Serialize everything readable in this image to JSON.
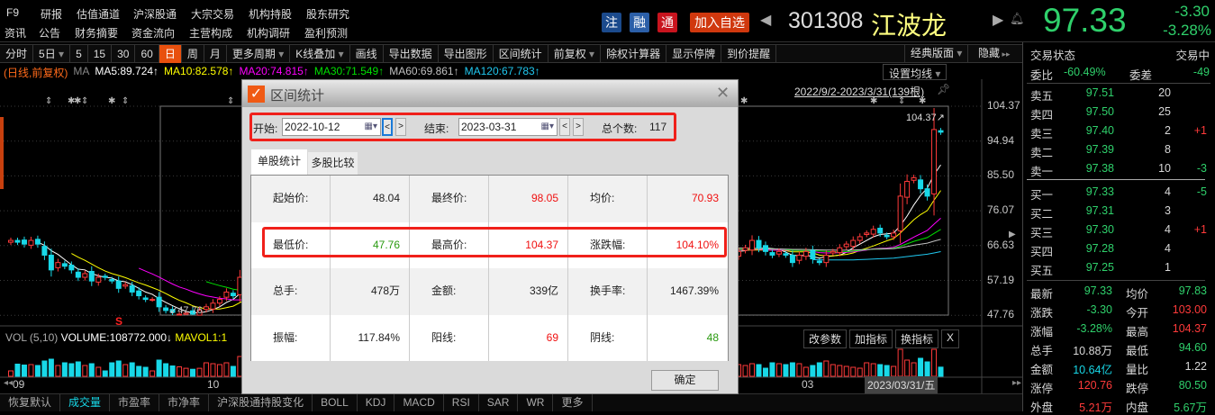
{
  "top_menu": {
    "row1": [
      "F9",
      "研报",
      "估值通道",
      "沪深股通",
      "大宗交易",
      "机构持股",
      "股东研究"
    ],
    "row2": [
      "资讯",
      "公告",
      "财务摘要",
      "资金流向",
      "主营构成",
      "机构调研",
      "盈利预测"
    ]
  },
  "header": {
    "badges": [
      {
        "label": "注",
        "color": "#1b4a8c"
      },
      {
        "label": "融",
        "color": "#2b5fa8"
      },
      {
        "label": "通",
        "color": "#c8141e"
      }
    ],
    "add_watchlist": "加入自选",
    "code": "301308",
    "name": "江波龙",
    "price": "97.33",
    "change": "-3.30",
    "change_pct": "-3.28%"
  },
  "toolbar": {
    "items": [
      {
        "label": "分时"
      },
      {
        "label": "5日",
        "dropdown": true
      },
      {
        "label": "5"
      },
      {
        "label": "15"
      },
      {
        "label": "30"
      },
      {
        "label": "60"
      },
      {
        "label": "日",
        "active": true
      },
      {
        "label": "周"
      },
      {
        "label": "月"
      },
      {
        "label": "更多周期",
        "dropdown": true
      },
      {
        "label": "K线叠加",
        "dropdown": true
      },
      {
        "label": "画线"
      },
      {
        "label": "导出数据"
      },
      {
        "label": "导出图形"
      },
      {
        "label": "区间统计"
      },
      {
        "label": "前复权",
        "dropdown": true
      },
      {
        "label": "除权计算器"
      },
      {
        "label": "显示停牌"
      },
      {
        "label": "到价提醒"
      }
    ],
    "layout": "经典版面",
    "hide": "隐藏"
  },
  "ma_row": {
    "prefix": "(日线,前复权)",
    "ma": "MA",
    "items": [
      {
        "text": "MA5:89.724↑",
        "color": "#ffffff"
      },
      {
        "text": "MA10:82.578↑",
        "color": "#ffff00"
      },
      {
        "text": "MA20:74.815↑",
        "color": "#ff00ff"
      },
      {
        "text": "MA30:71.549↑",
        "color": "#00e000"
      },
      {
        "text": "MA60:69.861↑",
        "color": "#c0c0c0"
      },
      {
        "text": "MA120:67.783↑",
        "color": "#20c8f0"
      }
    ],
    "set_ma": "设置均线"
  },
  "chart": {
    "range_label": "2022/9/2-2023/3/31(139根)",
    "price_axis": [
      "104.37",
      "94.94",
      "85.50",
      "76.07",
      "66.63",
      "57.19",
      "47.76"
    ],
    "low_marker": "47.76",
    "high_marker": "104.37",
    "closes": [
      68,
      67.5,
      67,
      68,
      67,
      64,
      60,
      62,
      61,
      60,
      58,
      59,
      57,
      58,
      58,
      57,
      55,
      56,
      54,
      53,
      52,
      52,
      50,
      49,
      48.5,
      48,
      48.3,
      48.04,
      49,
      50,
      51,
      52,
      54,
      53,
      58,
      57,
      60,
      59,
      62,
      63,
      62,
      64,
      66,
      65,
      67,
      68,
      66,
      67,
      69,
      68,
      70,
      69,
      67,
      68,
      66,
      67,
      66,
      65,
      66,
      67,
      66,
      65,
      67,
      68,
      66,
      65,
      64,
      66,
      67,
      68,
      67,
      66,
      65,
      64,
      63,
      64,
      65,
      66,
      67,
      66,
      65,
      64,
      65,
      66,
      67,
      68,
      67,
      66,
      65,
      64,
      66,
      67,
      68,
      66,
      65,
      64,
      63,
      65,
      66,
      67,
      68,
      66,
      65,
      64,
      65,
      66,
      65,
      64,
      65,
      66,
      68,
      66,
      65,
      64,
      65,
      64,
      62,
      64,
      65,
      63,
      62,
      64,
      65,
      66,
      67,
      68,
      69,
      70,
      71,
      70,
      69,
      70,
      80,
      84,
      85,
      82,
      80,
      98.05,
      97.33
    ]
  },
  "volume": {
    "label": "VOL (5,10)",
    "volume_text": "VOLUME:108772.000↓",
    "mavol_text": "MAVOL1:1",
    "buttons": [
      "改参数",
      "加指标",
      "换指标",
      "X"
    ]
  },
  "date_axis": {
    "labels": [
      "09",
      "10",
      "03"
    ],
    "cursor_date": "2023/03/31/五"
  },
  "bottom_tabs": [
    "恢复默认",
    "成交量",
    "市盈率",
    "市净率",
    "沪深股通持股变化",
    "BOLL",
    "KDJ",
    "MACD",
    "RSI",
    "SAR",
    "WR",
    "更多"
  ],
  "right_panel": {
    "status_label": "交易状态",
    "status_value": "交易中",
    "ratio_label": "委比",
    "ratio_value": "-60.49%",
    "diff_label": "委差",
    "diff_value": "-49",
    "asks": [
      {
        "label": "卖五",
        "price": "97.51",
        "vol": "20",
        "chg": ""
      },
      {
        "label": "卖四",
        "price": "97.50",
        "vol": "25",
        "chg": ""
      },
      {
        "label": "卖三",
        "price": "97.40",
        "vol": "2",
        "chg": "+1"
      },
      {
        "label": "卖二",
        "price": "97.39",
        "vol": "8",
        "chg": ""
      },
      {
        "label": "卖一",
        "price": "97.38",
        "vol": "10",
        "chg": "-3"
      }
    ],
    "bids": [
      {
        "label": "买一",
        "price": "97.33",
        "vol": "4",
        "chg": "-5"
      },
      {
        "label": "买二",
        "price": "97.31",
        "vol": "3",
        "chg": ""
      },
      {
        "label": "买三",
        "price": "97.30",
        "vol": "4",
        "chg": "+1"
      },
      {
        "label": "买四",
        "price": "97.28",
        "vol": "4",
        "chg": ""
      },
      {
        "label": "买五",
        "price": "97.25",
        "vol": "1",
        "chg": ""
      }
    ],
    "stats": [
      {
        "l1": "最新",
        "v1": "97.33",
        "c1": "g",
        "l2": "均价",
        "v2": "97.83",
        "c2": "g"
      },
      {
        "l1": "涨跌",
        "v1": "-3.30",
        "c1": "g",
        "l2": "今开",
        "v2": "103.00",
        "c2": "r"
      },
      {
        "l1": "涨幅",
        "v1": "-3.28%",
        "c1": "g",
        "l2": "最高",
        "v2": "104.37",
        "c2": "r"
      },
      {
        "l1": "总手",
        "v1": "10.88万",
        "c1": "w",
        "l2": "最低",
        "v2": "94.60",
        "c2": "g"
      },
      {
        "l1": "金额",
        "v1": "10.64亿",
        "c1": "c",
        "l2": "量比",
        "v2": "1.22",
        "c2": "w"
      },
      {
        "l1": "涨停",
        "v1": "120.76",
        "c1": "r",
        "l2": "跌停",
        "v2": "80.50",
        "c2": "g"
      },
      {
        "l1": "外盘",
        "v1": "5.21万",
        "c1": "r",
        "l2": "内盘",
        "v2": "5.67万",
        "c2": "g"
      }
    ]
  },
  "dialog": {
    "title": "区间统计",
    "start_label": "开始:",
    "start_date": "2022-10-12",
    "end_label": "结束:",
    "end_date": "2023-03-31",
    "prev": "<",
    "next": ">",
    "count_label": "总个数:",
    "count_value": "117",
    "tabs": [
      "单股统计",
      "多股比较"
    ],
    "rows": [
      [
        {
          "l": "起始价:",
          "v": "48.04",
          "c": "#222"
        },
        {
          "l": "最终价:",
          "v": "98.05",
          "c": "#f01010"
        },
        {
          "l": "均价:",
          "v": "70.93",
          "c": "#f01010"
        }
      ],
      [
        {
          "l": "最低价:",
          "v": "47.76",
          "c": "#2a9a10"
        },
        {
          "l": "最高价:",
          "v": "104.37",
          "c": "#f01010"
        },
        {
          "l": "涨跌幅:",
          "v": "104.10%",
          "c": "#f01010"
        }
      ],
      [
        {
          "l": "总手:",
          "v": "478万",
          "c": "#222"
        },
        {
          "l": "金额:",
          "v": "339亿",
          "c": "#222"
        },
        {
          "l": "换手率:",
          "v": "1467.39%",
          "c": "#222"
        }
      ],
      [
        {
          "l": "振幅:",
          "v": "117.84%",
          "c": "#222"
        },
        {
          "l": "阳线:",
          "v": "69",
          "c": "#f01010"
        },
        {
          "l": "阴线:",
          "v": "48",
          "c": "#2a9a10"
        }
      ]
    ],
    "ok": "确定"
  }
}
